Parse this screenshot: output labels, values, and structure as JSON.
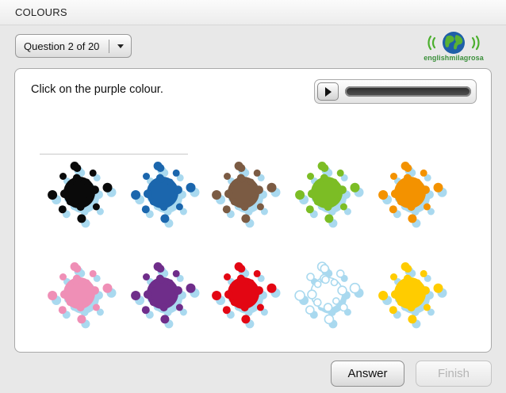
{
  "header": {
    "title": "COLOURS"
  },
  "question_selector": {
    "label": "Question 2 of 20",
    "icon": "chevron-down-icon"
  },
  "logo": {
    "text": "englishmilagrosa",
    "icon": "globe-icon"
  },
  "question": {
    "prompt": "Click on the purple colour."
  },
  "audio_player": {
    "play_icon": "play-icon",
    "progress": 0
  },
  "colours": [
    {
      "name": "black",
      "color": "#0a0a0a"
    },
    {
      "name": "blue",
      "color": "#1b66ad"
    },
    {
      "name": "brown",
      "color": "#7b5b43"
    },
    {
      "name": "green",
      "color": "#7cbd25"
    },
    {
      "name": "orange",
      "color": "#f39200"
    },
    {
      "name": "pink",
      "color": "#ef8fb6"
    },
    {
      "name": "purple",
      "color": "#6f2d8a"
    },
    {
      "name": "red",
      "color": "#e30613"
    },
    {
      "name": "white",
      "color": "#ffffff"
    },
    {
      "name": "yellow",
      "color": "#ffcc00"
    }
  ],
  "shadow_color": "#a9d9ef",
  "buttons": {
    "answer": "Answer",
    "finish": "Finish"
  }
}
